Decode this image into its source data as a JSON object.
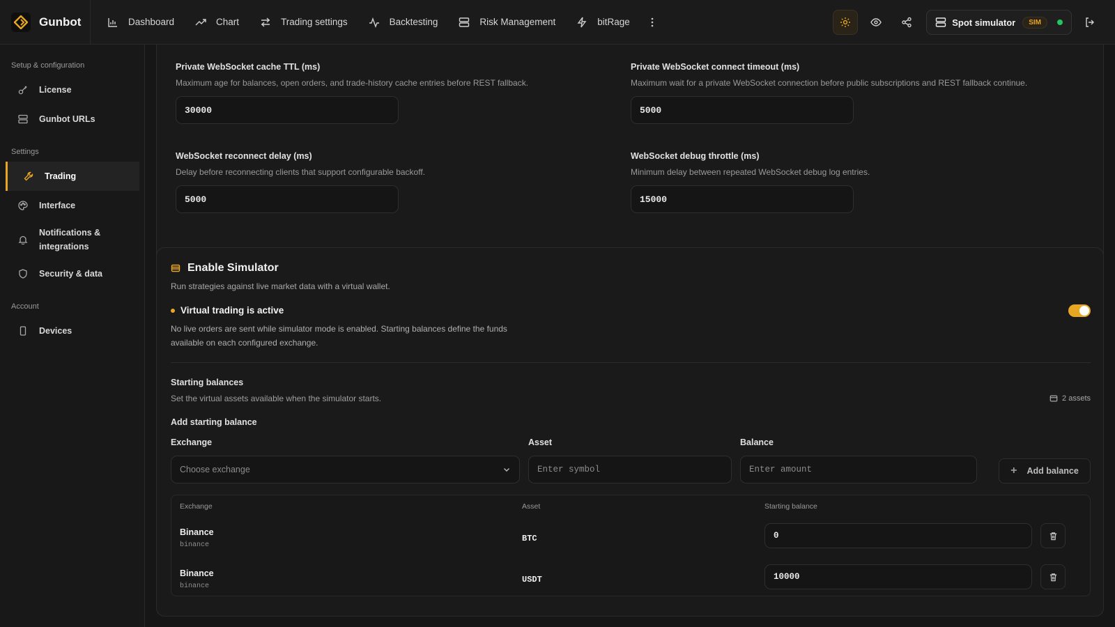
{
  "app": {
    "name": "Gunbot"
  },
  "nav": {
    "items": [
      {
        "label": "Dashboard",
        "icon": "bar-chart-icon"
      },
      {
        "label": "Chart",
        "icon": "trend-up-icon"
      },
      {
        "label": "Trading settings",
        "icon": "arrows-swap-icon"
      },
      {
        "label": "Backtesting",
        "icon": "activity-icon"
      },
      {
        "label": "Risk Management",
        "icon": "server-icon"
      },
      {
        "label": "bitRage",
        "icon": "zap-icon"
      }
    ]
  },
  "topbar": {
    "simulator_label": "Spot simulator",
    "simulator_badge": "SIM"
  },
  "sidebar": {
    "sections": [
      {
        "title": "Setup & configuration",
        "items": [
          "License",
          "Gunbot URLs"
        ]
      },
      {
        "title": "Settings",
        "items": [
          "Trading",
          "Interface",
          "Notifications & integrations",
          "Security & data"
        ]
      },
      {
        "title": "Account",
        "items": [
          "Devices"
        ]
      }
    ],
    "active": "Trading"
  },
  "websocket": {
    "cache_ttl": {
      "label": "Private WebSocket cache TTL (ms)",
      "help": "Maximum age for balances, open orders, and trade-history cache entries before REST fallback.",
      "value": "30000"
    },
    "connect_timeout": {
      "label": "Private WebSocket connect timeout (ms)",
      "help": "Maximum wait for a private WebSocket connection before public subscriptions and REST fallback continue.",
      "value": "5000"
    },
    "reconnect_delay": {
      "label": "WebSocket reconnect delay (ms)",
      "help": "Delay before reconnecting clients that support configurable backoff.",
      "value": "5000"
    },
    "debug_throttle": {
      "label": "WebSocket debug throttle (ms)",
      "help": "Minimum delay between repeated WebSocket debug log entries.",
      "value": "15000"
    }
  },
  "simulator": {
    "title": "Enable Simulator",
    "subtitle": "Run strategies against live market data with a virtual wallet.",
    "status_title": "Virtual trading is active",
    "status_desc": "No live orders are sent while simulator mode is enabled. Starting balances define the funds available on each configured exchange.",
    "enabled": true,
    "starting_title": "Starting balances",
    "starting_sub": "Set the virtual assets available when the simulator starts.",
    "assets_count": "2 assets",
    "add_title": "Add starting balance",
    "exchange_label": "Exchange",
    "exchange_placeholder": "Choose exchange",
    "asset_label": "Asset",
    "asset_placeholder": "Enter symbol",
    "balance_label": "Balance",
    "balance_placeholder": "Enter amount",
    "add_button": "Add balance",
    "table": {
      "headers": [
        "Exchange",
        "Asset",
        "Starting balance"
      ],
      "rows": [
        {
          "exchange": "Binance",
          "exchange_id": "binance",
          "asset": "BTC",
          "balance": "0"
        },
        {
          "exchange": "Binance",
          "exchange_id": "binance",
          "asset": "USDT",
          "balance": "10000"
        }
      ]
    }
  },
  "colors": {
    "accent": "#e8a623",
    "online": "#22c55e",
    "background": "#161616"
  }
}
